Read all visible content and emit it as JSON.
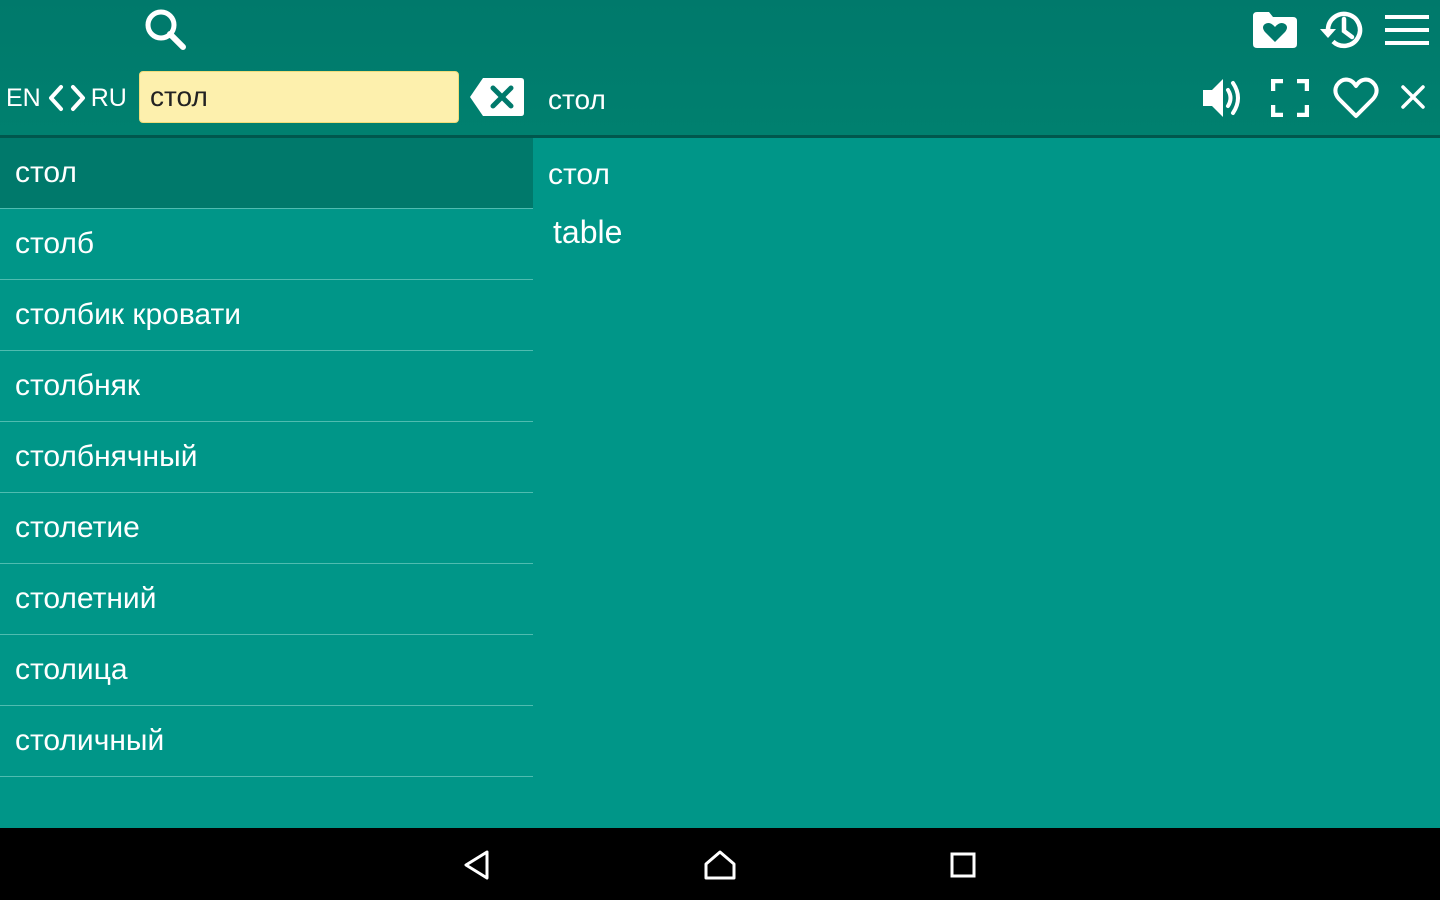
{
  "toolbar": {
    "search_icon": "search-icon",
    "favorites_folder_icon": "favorites-folder-icon",
    "history_icon": "history-icon",
    "menu_icon": "menu-icon"
  },
  "language": {
    "source": "EN",
    "target": "RU"
  },
  "search": {
    "value": "стол"
  },
  "header": {
    "word": "стол",
    "actions": [
      "speaker-icon",
      "fullscreen-icon",
      "heart-icon",
      "close-icon"
    ]
  },
  "word_list": [
    "стол",
    "столб",
    "столбик кровати",
    "столбняк",
    "столбнячный",
    "столетие",
    "столетний",
    "столица",
    "столичный"
  ],
  "selected_index": 0,
  "entry": {
    "headword": "стол",
    "translation": "table"
  },
  "navbar": {
    "back_icon": "back-icon",
    "home_icon": "home-icon",
    "recents_icon": "recents-icon"
  },
  "colors": {
    "background": "#009688",
    "toolbar": "#00796b",
    "selected_row": "#00796b",
    "search_field": "#fdf0ad",
    "navbar": "#000000"
  }
}
